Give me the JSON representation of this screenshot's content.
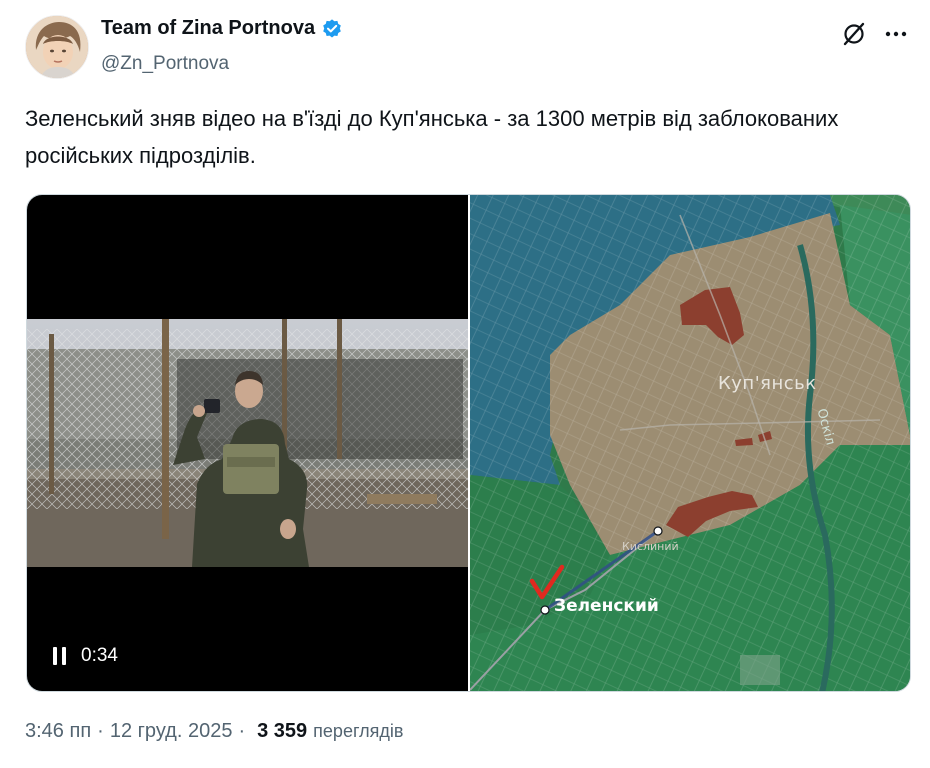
{
  "author": {
    "display_name": "Team of Zina Portnova",
    "handle": "@Zn_Portnova",
    "verified": true
  },
  "tweet": {
    "text": "Зеленський зняв відео на в'їзді до Куп'янська - за 1300 метрів від заблокованих російських підрозділів."
  },
  "video": {
    "timer": "0:34",
    "state": "playing"
  },
  "map": {
    "city_label": "Куп'янськ",
    "river_label": "Оскіл",
    "village_label": "Кислиний",
    "place_label": "Зеленский"
  },
  "meta": {
    "time": "3:46 пп",
    "separator": "·",
    "date": "12 груд. 2025",
    "views_count": "3 359",
    "views_label": "переглядів"
  },
  "icons": {
    "verified": "verified-badge-icon",
    "grok": "grok-icon",
    "more": "more-icon",
    "pause": "pause-icon"
  },
  "colors": {
    "verified": "#1d9bf0",
    "text_primary": "#0f1419",
    "text_secondary": "#536471"
  }
}
